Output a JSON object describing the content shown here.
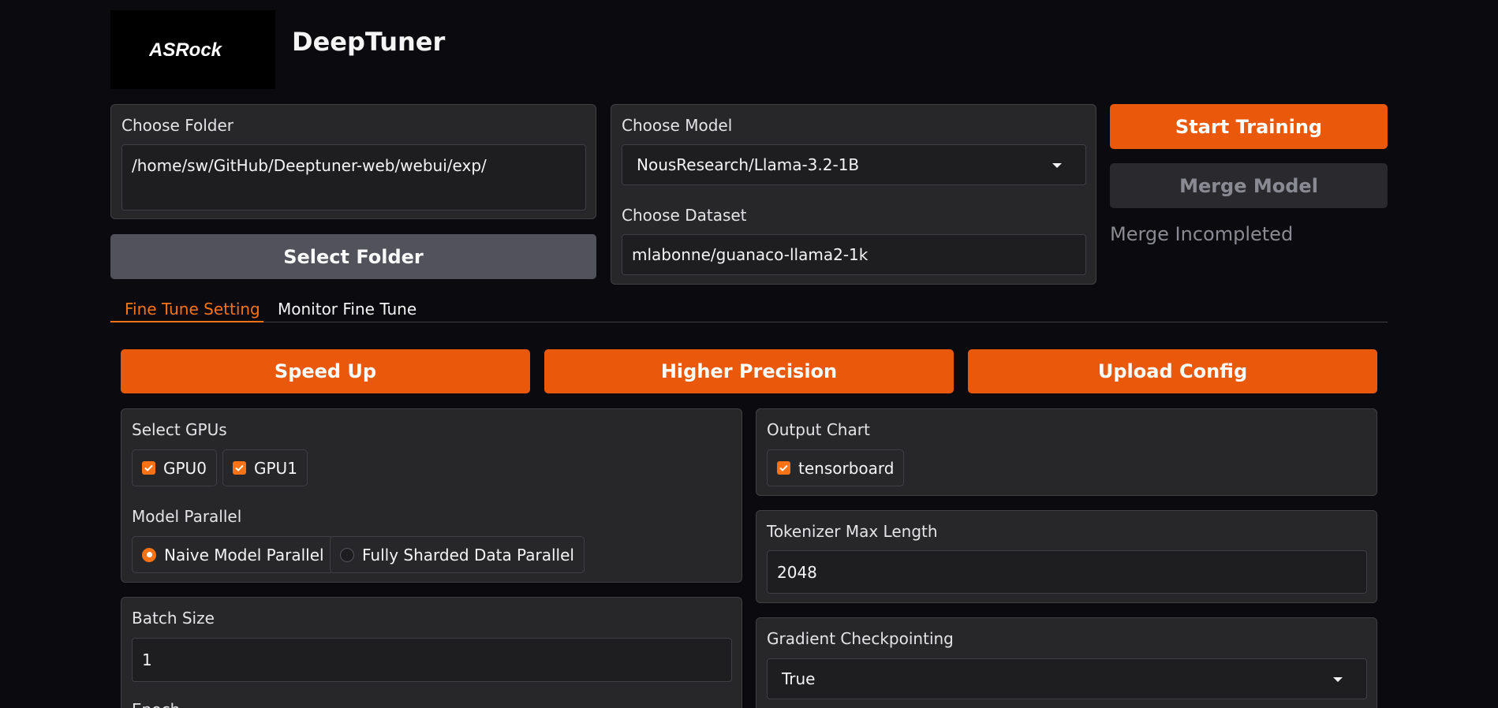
{
  "header": {
    "logo_text": "ASRock",
    "title": "DeepTuner"
  },
  "folder": {
    "label": "Choose Folder",
    "value": "/home/sw/GitHub/Deeptuner-web/webui/exp/",
    "select_button": "Select Folder"
  },
  "model": {
    "label": "Choose Model",
    "value": "NousResearch/Llama-3.2-1B"
  },
  "dataset": {
    "label": "Choose Dataset",
    "value": "mlabonne/guanaco-llama2-1k"
  },
  "actions": {
    "start_training": "Start Training",
    "merge_model": "Merge Model",
    "merge_status": "Merge Incompleted"
  },
  "tabs": [
    {
      "label": "Fine Tune Setting",
      "active": true
    },
    {
      "label": "Monitor Fine Tune",
      "active": false
    }
  ],
  "presets": {
    "speed_up": "Speed Up",
    "higher_precision": "Higher Precision",
    "upload_config": "Upload Config"
  },
  "gpus": {
    "label": "Select GPUs",
    "options": [
      {
        "label": "GPU0",
        "checked": true
      },
      {
        "label": "GPU1",
        "checked": true
      }
    ]
  },
  "parallel": {
    "label": "Model Parallel",
    "options": [
      {
        "label": "Naive Model Parallel",
        "selected": true
      },
      {
        "label": "Fully Sharded Data Parallel",
        "selected": false
      }
    ]
  },
  "output_chart": {
    "label": "Output Chart",
    "options": [
      {
        "label": "tensorboard",
        "checked": true
      }
    ]
  },
  "tokenizer": {
    "label": "Tokenizer Max Length",
    "value": "2048"
  },
  "batch": {
    "label": "Batch Size",
    "value": "1",
    "next_label_partial": "Epoch"
  },
  "gradient": {
    "label": "Gradient Checkpointing",
    "value": "True"
  },
  "colors": {
    "accent": "#ea580c",
    "background": "#0b0b0f",
    "panel": "#27272a"
  }
}
